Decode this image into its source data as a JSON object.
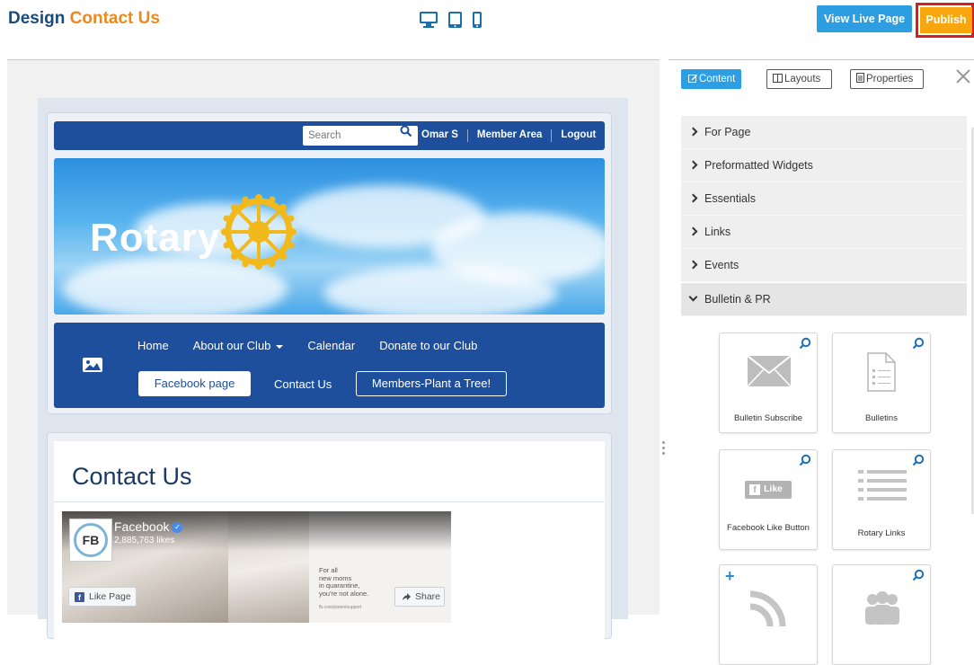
{
  "header": {
    "title_prefix": "Design",
    "title_page": "Contact Us",
    "devices": [
      "desktop-icon",
      "tablet-icon",
      "mobile-icon"
    ],
    "view_live_label": "View Live Page",
    "publish_label": "Publish",
    "colors": {
      "title": "#1a4b7c",
      "accent": "#ea8a1d",
      "live": "#2e9ee3",
      "publish": "#f7a60e",
      "highlight": "#d81d1d"
    }
  },
  "site": {
    "search_placeholder": "Search",
    "top_links": [
      "Omar S",
      "Member Area",
      "Logout"
    ],
    "hero_text": "Rotary",
    "menu": [
      "Home",
      "About our Club",
      "Calendar",
      "Donate to our Club"
    ],
    "facebook_page_label": "Facebook page",
    "contact_us_label": "Contact Us",
    "members_label": "Members-Plant a Tree!",
    "content_title": "Contact Us",
    "colors": {
      "nav": "#1d4f9c"
    }
  },
  "facebook": {
    "logo_text": "FB",
    "name": "Facebook",
    "likes": "2,885,763 likes",
    "tagline": "For all\nnew moms\nin quarantine,\nyou're not alone.",
    "url_text": "fb.com/parentsupport",
    "like_label": "Like Page",
    "share_label": "Share"
  },
  "panel": {
    "tabs": [
      "Content",
      "Layouts",
      "Properties"
    ],
    "sections": [
      "For Page",
      "Preformatted Widgets",
      "Essentials",
      "Links",
      "Events",
      "Bulletin & PR"
    ],
    "widgets": [
      {
        "label": "Bulletin Subscribe",
        "icon": "envelope-icon"
      },
      {
        "label": "Bulletins",
        "icon": "document-icon"
      },
      {
        "label": "Facebook Like Button",
        "icon": "facebook-like-icon",
        "badge": "Like"
      },
      {
        "label": "Rotary Links",
        "icon": "list-icon"
      },
      {
        "label": "",
        "icon": "rss-icon"
      },
      {
        "label": "",
        "icon": "people-icon"
      }
    ]
  }
}
